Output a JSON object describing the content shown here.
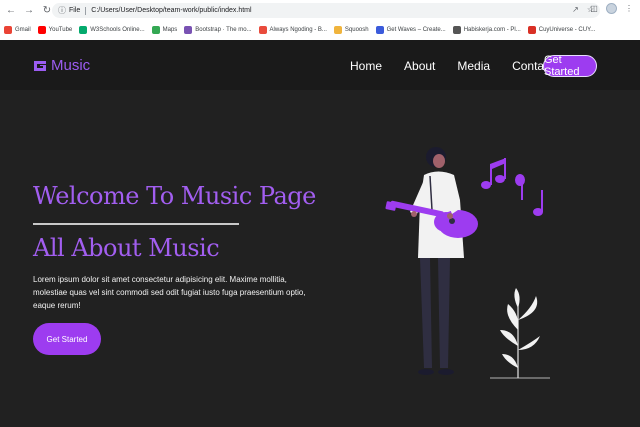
{
  "browser": {
    "omnibox": {
      "protocol_label": "File",
      "url": "C:/Users/User/Desktop/team-work/public/index.html"
    },
    "bookmarks": [
      {
        "label": "Gmail",
        "icon": "gmail-icon",
        "color": "#ea4335"
      },
      {
        "label": "YouTube",
        "icon": "youtube-icon",
        "color": "#ff0000"
      },
      {
        "label": "W3Schools Online...",
        "icon": "w3schools-icon",
        "color": "#04aa6d"
      },
      {
        "label": "Maps",
        "icon": "maps-icon",
        "color": "#34a853"
      },
      {
        "label": "Bootstrap · The mo...",
        "icon": "bootstrap-icon",
        "color": "#7952b3"
      },
      {
        "label": "Always Ngoding - B...",
        "icon": "always-ngoding-icon",
        "color": "#e94b3c"
      },
      {
        "label": "Squoosh",
        "icon": "squoosh-icon",
        "color": "#f0b43d"
      },
      {
        "label": "Get Waves – Create...",
        "icon": "get-waves-icon",
        "color": "#3b5bdb"
      },
      {
        "label": "Habiskerja.com - Pl...",
        "icon": "habiskerja-icon",
        "color": "#555555"
      },
      {
        "label": "CuyUniverse - CUY...",
        "icon": "cuyuniverse-icon",
        "color": "#d93025"
      }
    ]
  },
  "site": {
    "logo_text": "Music",
    "nav": [
      "Home",
      "About",
      "Media",
      "Contact"
    ],
    "cta_label": "Get Started",
    "hero": {
      "title_line1": "Welcome To Music Page",
      "title_line2": "All About Music",
      "paragraph": "Lorem ipsum dolor sit amet consectetur adipisicing elit. Maxime mollitia, molestiae quas vel sint commodi sed odit fugiat iusto fuga praesentium optio, eaque rerum!",
      "button_label": "Get Started"
    },
    "colors": {
      "accent": "#9d3cf0",
      "heading": "#a25ef0",
      "background": "#212121",
      "header": "#1a1a1a"
    }
  }
}
